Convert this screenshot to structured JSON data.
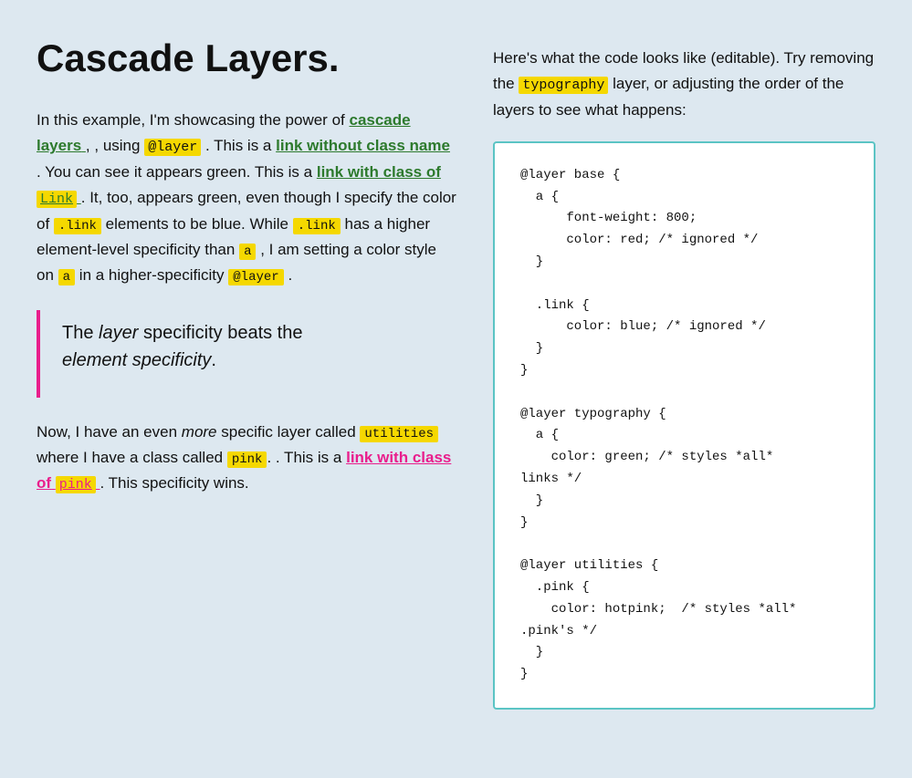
{
  "title": "Cascade Layers.",
  "left": {
    "intro": "In this example, I'm showcasing the power of",
    "cascade_layers_text": "cascade layers",
    "intro2": ", using",
    "at_layer_code": "@layer",
    "intro3": ". This is a",
    "link_no_class_text": "link without class name",
    "intro4": ". You can see it appears green. This is a",
    "link_with_class_text": "link with class of",
    "link_code": "Link",
    "intro5": ". It, too, appears green, even though I specify the color of",
    "link_code2": ".link",
    "intro6": "elements to be blue. While",
    "link_code3": ".link",
    "intro7": "has a higher element-level specificity than",
    "a_code": "a",
    "intro8": ", I am setting a color style on",
    "a_code2": "a",
    "intro9": "in a higher-specificity",
    "at_layer_code2": "@layer",
    "intro10": ".",
    "blockquote_line1": "The",
    "blockquote_em1": "layer",
    "blockquote_line2": "specificity beats the",
    "blockquote_em2": "element specificity",
    "blockquote_end": ".",
    "para2_start": "Now, I have an even",
    "para2_em": "more",
    "para2_mid": "specific layer called",
    "utilities_code": "utilities",
    "para2_mid2": "where I have a class called",
    "pink_code": "pink",
    "para2_end": ". This is a",
    "link_pink_text": "link with class of",
    "pink_highlight": "pink",
    "para2_final": ". This specificity wins."
  },
  "right": {
    "description_1": "Here's what the code looks like (editable). Try removing the",
    "typography_highlight": "typography",
    "description_2": "layer, or adjusting the order of the layers to see what happens:",
    "code": "@layer base {\n  a {\n      font-weight: 800;\n      color: red; /* ignored */\n  }\n\n  .link {\n      color: blue; /* ignored */\n  }\n}\n\n@layer typography {\n  a {\n    color: green; /* styles *all*\nlinks */\n  }\n}\n\n@layer utilities {\n  .pink {\n    color: hotpink;  /* styles *all*\n.pink's */\n  }\n}"
  }
}
